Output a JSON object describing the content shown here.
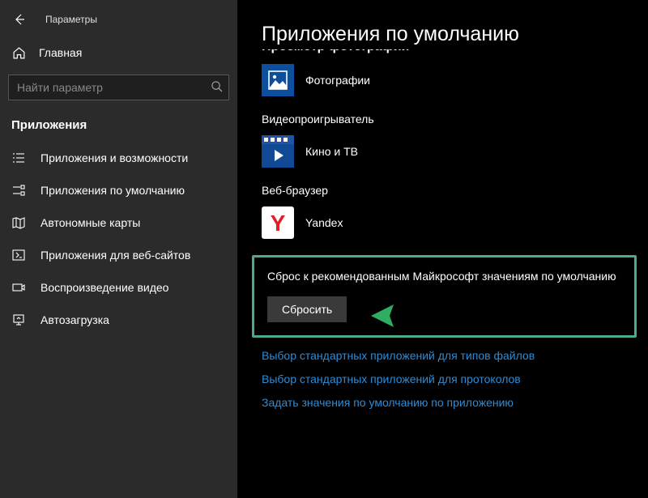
{
  "window": {
    "title": "Параметры"
  },
  "sidebar": {
    "home": "Главная",
    "search_placeholder": "Найти параметр",
    "category": "Приложения",
    "items": [
      {
        "label": "Приложения и возможности"
      },
      {
        "label": "Приложения по умолчанию"
      },
      {
        "label": "Автономные карты"
      },
      {
        "label": "Приложения для веб-сайтов"
      },
      {
        "label": "Воспроизведение видео"
      },
      {
        "label": "Автозагрузка"
      }
    ]
  },
  "main": {
    "title": "Приложения по умолчанию",
    "cutoff_section": "Просмотр фотографий",
    "sections": [
      {
        "label": "",
        "app": "Фотографии"
      },
      {
        "label": "Видеопроигрыватель",
        "app": "Кино и ТВ"
      },
      {
        "label": "Веб-браузер",
        "app": "Yandex"
      }
    ],
    "reset": {
      "title": "Сброс к рекомендованным Майкрософт значениям по умолчанию",
      "button": "Сбросить"
    },
    "links": [
      "Выбор стандартных приложений для типов файлов",
      "Выбор стандартных приложений для протоколов",
      "Задать значения по умолчанию по приложению"
    ]
  }
}
